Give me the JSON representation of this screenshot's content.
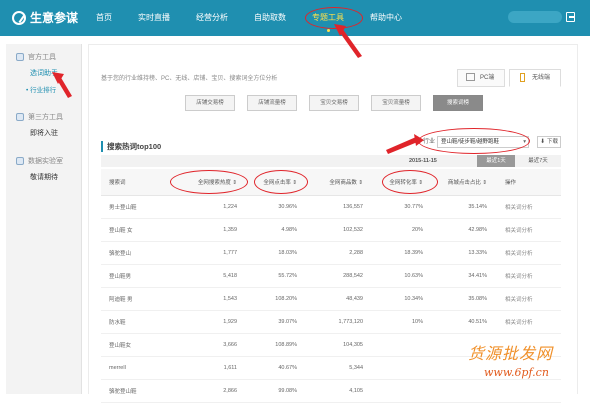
{
  "header": {
    "logo_text": "生意参谋",
    "nav": [
      "首页",
      "实时直播",
      "经营分析",
      "自助取数",
      "专题工具",
      "帮助中心"
    ],
    "active_nav": "专题工具"
  },
  "sidebar": {
    "groups": [
      {
        "title": "官方工具",
        "items": [
          "选词助手",
          "• 行业排行"
        ]
      },
      {
        "title": "第三方工具",
        "items": [
          "即将入驻"
        ]
      },
      {
        "title": "数据实验室",
        "items": [
          "敬请期待"
        ]
      }
    ]
  },
  "main": {
    "description": "基于您的行业维持榜、PC、无线、店铺、宝贝、搜索词全方位分析",
    "device_tabs": [
      "PC端",
      "无线端"
    ],
    "sub_tabs": [
      "店铺交易榜",
      "店铺流量榜",
      "宝贝交易榜",
      "宝贝流量榜",
      "搜索词榜"
    ],
    "section_title": "搜索热词top100",
    "industry_label": "行业",
    "industry_value": "登山鞋/徒步鞋/越野跑鞋",
    "download_label": "下载",
    "date": "2015-11-15",
    "period_buttons": [
      "最近1天",
      "最近7天"
    ]
  },
  "table": {
    "columns": [
      "搜索词",
      "全网搜索热度 ⇕",
      "全网点击率 ⇕",
      "全网商品数 ⇕",
      "全网转化率 ⇕",
      "商城点击占比 ⇕",
      "操作"
    ],
    "rows": [
      [
        "男士登山鞋",
        "1,224",
        "30.96%",
        "136,557",
        "30.77%",
        "35.14%",
        "相关词分析"
      ],
      [
        "登山鞋 女",
        "1,359",
        "4.98%",
        "102,532",
        "20%",
        "42.98%",
        "相关词分析"
      ],
      [
        "骆驼登山",
        "1,777",
        "18.03%",
        "2,288",
        "18.39%",
        "13.33%",
        "相关词分析"
      ],
      [
        "登山鞋男",
        "5,418",
        "55.72%",
        "288,542",
        "10.63%",
        "34.41%",
        "相关词分析"
      ],
      [
        "阿迪鞋 男",
        "1,543",
        "108.20%",
        "48,439",
        "10.34%",
        "35.08%",
        "相关词分析"
      ],
      [
        "防水鞋",
        "1,929",
        "39.07%",
        "1,773,120",
        "10%",
        "40.51%",
        "相关词分析"
      ],
      [
        "登山鞋女",
        "3,666",
        "108.89%",
        "104,305",
        "",
        "",
        ""
      ],
      [
        "merrell",
        "1,611",
        "40.67%",
        "5,344",
        "",
        "",
        ""
      ],
      [
        "骆驼登山鞋",
        "2,866",
        "99.08%",
        "4,105",
        "",
        "",
        ""
      ]
    ]
  },
  "watermark": {
    "cn": "货源批发网",
    "url": "www.6pf.cn"
  },
  "colors": {
    "header": "#1f8fb0",
    "accent": "#ffe14a",
    "annotation": "#e0242a"
  }
}
